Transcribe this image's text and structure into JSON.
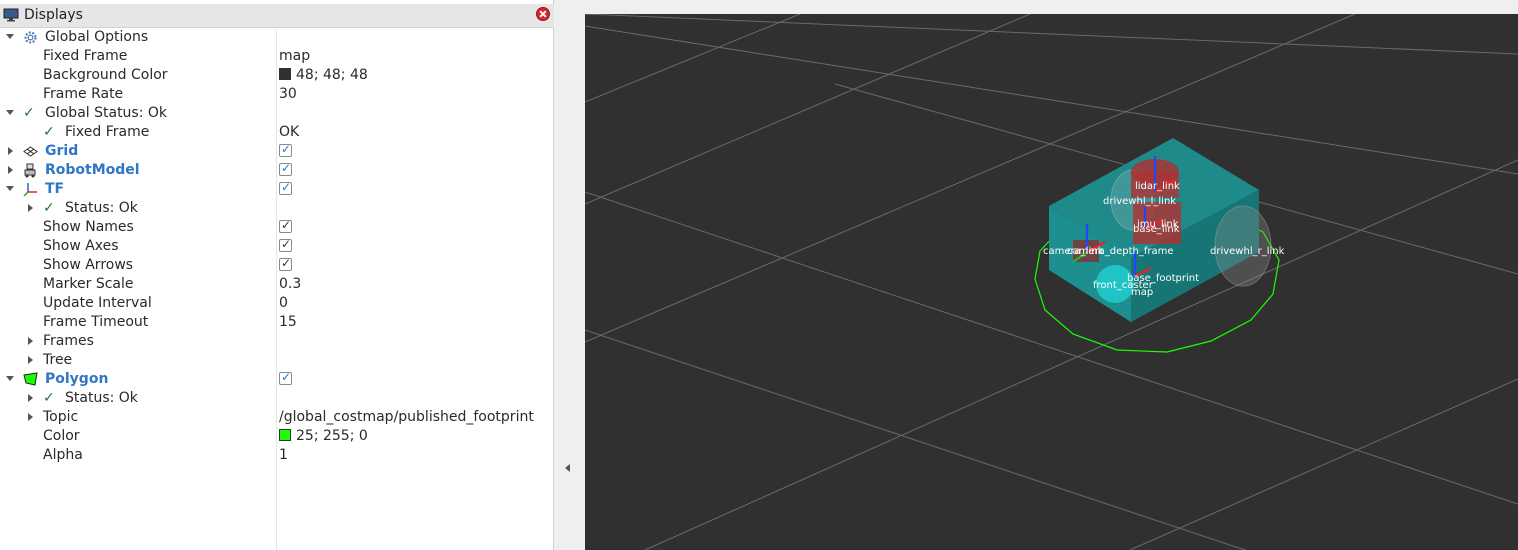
{
  "panel": {
    "title": "Displays",
    "rows": [
      {
        "label": "Global Options",
        "value": ""
      },
      {
        "label": "Fixed Frame",
        "value": "map"
      },
      {
        "label": "Background Color",
        "value": "48; 48; 48",
        "swatch": "#303030"
      },
      {
        "label": "Frame Rate",
        "value": "30"
      },
      {
        "label": "Global Status: Ok",
        "value": ""
      },
      {
        "label": "Fixed Frame",
        "value": "OK"
      },
      {
        "label": "Grid",
        "value": ""
      },
      {
        "label": "RobotModel",
        "value": ""
      },
      {
        "label": "TF",
        "value": ""
      },
      {
        "label": "Status: Ok",
        "value": ""
      },
      {
        "label": "Show Names",
        "value": ""
      },
      {
        "label": "Show Axes",
        "value": ""
      },
      {
        "label": "Show Arrows",
        "value": ""
      },
      {
        "label": "Marker Scale",
        "value": "0.3"
      },
      {
        "label": "Update Interval",
        "value": "0"
      },
      {
        "label": "Frame Timeout",
        "value": "15"
      },
      {
        "label": "Frames",
        "value": ""
      },
      {
        "label": "Tree",
        "value": ""
      },
      {
        "label": "Polygon",
        "value": ""
      },
      {
        "label": "Status: Ok",
        "value": ""
      },
      {
        "label": "Topic",
        "value": "/global_costmap/published_footprint"
      },
      {
        "label": "Color",
        "value": "25; 255; 0",
        "swatch": "#19ff00"
      },
      {
        "label": "Alpha",
        "value": "1"
      }
    ]
  },
  "viewport": {
    "background": "#303030",
    "frames": [
      {
        "text": "lidar_link"
      },
      {
        "text": "drivewhl_l_link"
      },
      {
        "text": "imu_link"
      },
      {
        "text": "base_link"
      },
      {
        "text": "camera_link"
      },
      {
        "text": "camera_depth_frame"
      },
      {
        "text": "drivewhl_r_link"
      },
      {
        "text": "base_footprint"
      },
      {
        "text": "front_caster"
      },
      {
        "text": "map"
      }
    ]
  }
}
